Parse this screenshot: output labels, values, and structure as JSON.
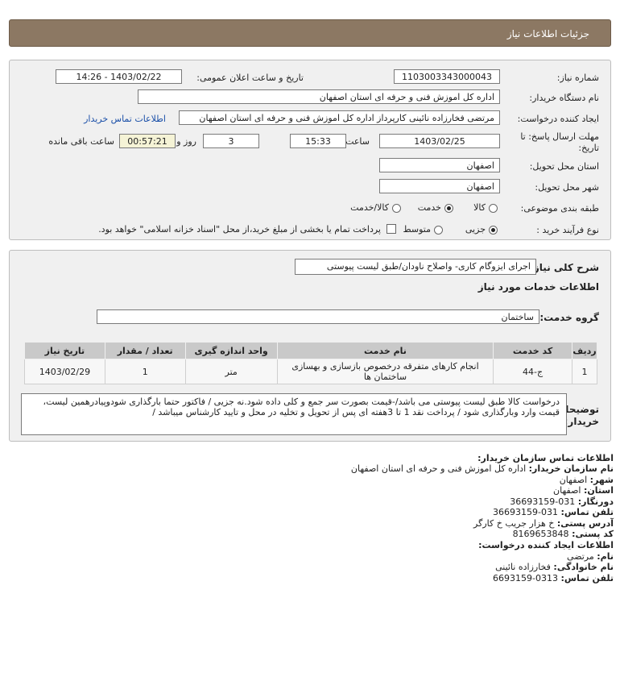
{
  "header": {
    "title": "جزئیات اطلاعات نیاز"
  },
  "details": {
    "need_number_label": "شماره نیاز:",
    "need_number": "1103003343000043",
    "announce_label": "تاریخ و ساعت اعلان عمومی:",
    "announce_value": "1403/02/22 - 14:26",
    "buyer_org_label": "نام دستگاه خریدار:",
    "buyer_org": "اداره کل اموزش فنی و حرفه ای استان اصفهان",
    "creator_label": "ایجاد کننده درخواست:",
    "creator": "مرتضی فخارزاده نائینی کارپرداز اداره کل اموزش فنی و حرفه ای استان اصفهان",
    "contact_link": "اطلاعات تماس خریدار",
    "deadline_label_1": "مهلت ارسال پاسخ: تا",
    "deadline_label_2": "تاریخ:",
    "deadline_date": "1403/02/25",
    "time_label": "ساعت",
    "deadline_time": "15:33",
    "days_value": "3",
    "days_label": "روز و",
    "remaining_time": "00:57:21",
    "remaining_label": "ساعت باقی مانده",
    "province_label": "استان محل تحویل:",
    "province": "اصفهان",
    "city_label": "شهر محل تحویل:",
    "city": "اصفهان",
    "category_label": "طبقه بندی موضوعی:",
    "category_options": [
      "کالا",
      "خدمت",
      "کالا/خدمت"
    ],
    "category_selected": "خدمت",
    "purchase_type_label": "نوع فرآیند خرید :",
    "purchase_options": [
      "جزیی",
      "متوسط"
    ],
    "purchase_selected": "جزیی",
    "treasury_text": "پرداخت تمام یا بخشی از مبلغ خرید،از محل \"اسناد خزانه اسلامی\" خواهد بود."
  },
  "need": {
    "summary_label": "شرح کلی نیاز:",
    "summary": "اجرای ایزوگام کاری- واصلاح ناودان/طبق لیست پیوستی",
    "services_heading": "اطلاعات خدمات مورد نیاز",
    "service_group_label": "گروه خدمت:",
    "service_group": "ساختمان",
    "table": {
      "headers": [
        "ردیف",
        "کد خدمت",
        "نام خدمت",
        "واحد اندازه گیری",
        "تعداد / مقدار",
        "تاریخ نیاز"
      ],
      "rows": [
        {
          "row": "1",
          "code": "ج-44",
          "name": "انجام کارهای متفرقه درخصوص بازسازی و بهسازی ساختمان ها",
          "unit": "متر",
          "qty": "1",
          "date": "1403/02/29"
        }
      ]
    },
    "buyer_notes_label_1": "توضیحات",
    "buyer_notes_label_2": "خریدار:",
    "buyer_notes": "درخواست کالا طبق لیست پیوستی می باشد/-قیمت بصورت سر جمع و کلی داده شود.نه جزیی / فاکتور حتما بارگذاری شودوپیادرهمین لیست، قیمت وارد وبارگذاری شود / پرداخت نقد 1 تا 3هفته ای پس از تحویل و تخلیه در محل و تایید کارشناس میباشد /"
  },
  "contact": {
    "buyer_title": "اطلاعات تماس سازمان خریدار:",
    "org_label": "نام سازمان خریدار:",
    "org": "اداره کل اموزش فنی و حرفه ای استان اصفهان",
    "city_label": "شهر:",
    "city": "اصفهان",
    "province_label": "استان:",
    "province": "اصفهان",
    "fax_label": "دورنگار:",
    "fax": "031-36693159",
    "phone_label": "تلفن تماس:",
    "phone": "031-36693159",
    "address_label": "آدرس پستی:",
    "address": "خ هزار جریب خ کارگر",
    "postal_label": "کد پستی:",
    "postal": "8169653848",
    "creator_title": "اطلاعات ایجاد کننده درخواست:",
    "name_label": "نام:",
    "name": "مرتضی",
    "family_label": "نام خانوادگی:",
    "family": "فخارزاده نائینی",
    "creator_phone_label": "تلفن تماس:",
    "creator_phone": "0313-6693159"
  }
}
